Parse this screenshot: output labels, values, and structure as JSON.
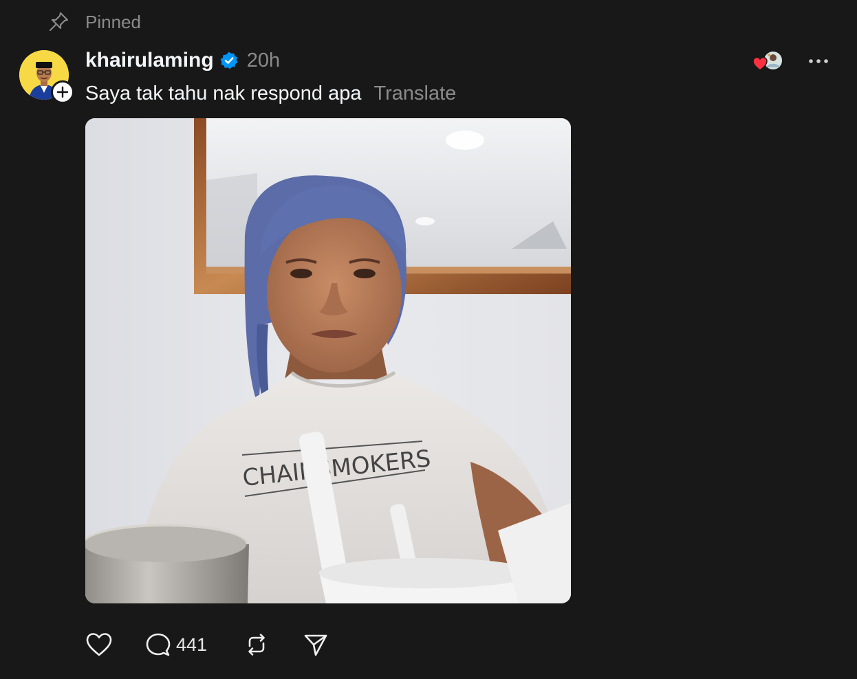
{
  "pinned": {
    "label": "Pinned",
    "icon": "pin-icon"
  },
  "post": {
    "username": "khairulaming",
    "verified_icon": "verified-badge-icon",
    "timestamp": "20h",
    "text": "Saya tak tahu nak respond apa",
    "translate_label": "Translate",
    "image_text": "CHAINSMOKERS",
    "accent_color": "#0095f6"
  },
  "actions": {
    "like_icon": "heart-icon",
    "reply_icon": "comment-icon",
    "reply_count": "441",
    "repost_icon": "repost-icon",
    "share_icon": "send-icon"
  },
  "colors": {
    "background": "#181818",
    "text_primary": "#f3f5f7",
    "text_secondary": "#8a8a8a",
    "heart": "#ff3040"
  }
}
